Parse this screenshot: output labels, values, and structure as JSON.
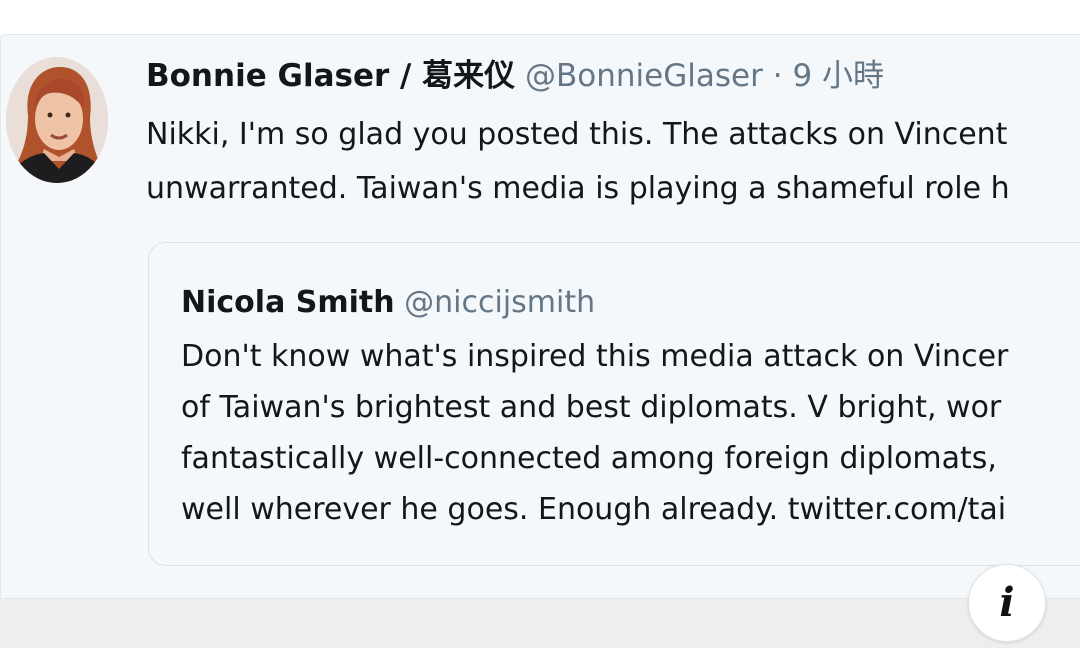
{
  "tweet": {
    "author_name": "Bonnie Glaser / 葛来仪",
    "author_handle": "@BonnieGlaser",
    "separator": "·",
    "time": "9 小時",
    "text_lines": [
      "Nikki, I'm so glad you posted this. The attacks on Vincent",
      "unwarranted. Taiwan's media is playing a shameful role h"
    ]
  },
  "quoted_tweet": {
    "author_name": "Nicola Smith",
    "author_handle": "@niccijsmith",
    "text_lines": [
      "Don't know what's inspired this media attack on Vincer",
      "of Taiwan's brightest and best diplomats. V bright, wor",
      "fantastically well-connected among foreign diplomats,",
      "well wherever he goes. Enough already. twitter.com/tai"
    ]
  },
  "info_button": {
    "icon": "info-icon",
    "glyph": "i"
  },
  "colors": {
    "card_background": "#f5f8fa",
    "primary_text": "#14171a",
    "secondary_text": "#657786",
    "border": "#e1e8ed"
  }
}
